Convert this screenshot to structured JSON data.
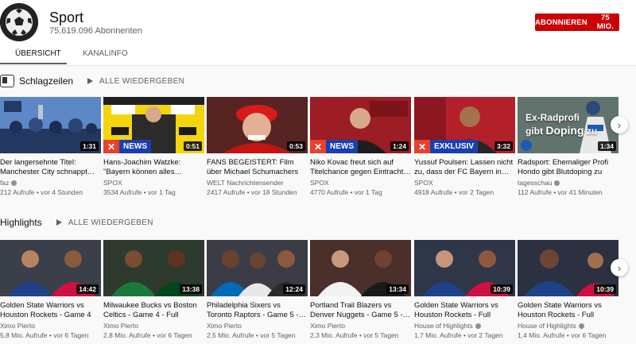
{
  "channel": {
    "title": "Sport",
    "subscribers": "75.619.096 Abonnenten",
    "subscribe_label": "ABONNIEREN",
    "subscribe_count": "75 MIO.",
    "accent": "#cc0000"
  },
  "tabs": [
    {
      "label": "ÜBERSICHT",
      "active": true
    },
    {
      "label": "KANALINFO",
      "active": false
    }
  ],
  "sections": [
    {
      "title": "Schlagzeilen",
      "play_all": "ALLE WIEDERGEBEN",
      "videos": [
        {
          "title": "Der langersehnte Titel: Manchester City schnappt…",
          "channel": "faz",
          "verified": true,
          "meta": "212 Aufrufe • vor 4 Stunden",
          "duration": "1:31",
          "badge": ""
        },
        {
          "title": "Hans-Joachim Watzke: \"Bayern können alles…",
          "channel": "SPOX",
          "verified": false,
          "meta": "3534 Aufrufe • vor 1 Tag",
          "duration": "0:51",
          "badge": "NEWS"
        },
        {
          "title": "FANS BEGEISTERT: Film über Michael Schumachers Lebe…",
          "channel": "WELT Nachrichtensender",
          "verified": false,
          "meta": "2417 Aufrufe • vor 18 Stunden",
          "duration": "0:53",
          "badge": ""
        },
        {
          "title": "Niko Kovac freut sich auf Titelchance gegen Eintracht…",
          "channel": "SPOX",
          "verified": false,
          "meta": "4770 Aufrufe • vor 1 Tag",
          "duration": "1:24",
          "badge": "NEWS"
        },
        {
          "title": "Yussuf Poulsen: Lassen nicht zu, dass der FC Bayern in…",
          "channel": "SPOX",
          "verified": false,
          "meta": "4918 Aufrufe • vor 2 Tagen",
          "duration": "3:32",
          "badge": "EXKLUSIV"
        },
        {
          "title": "Radsport: Ehemaliger Profi Hondo gibt Blutdoping zu",
          "channel": "tagesschau",
          "verified": true,
          "meta": "112 Aufrufe • vor 41 Minuten",
          "duration": "1:34",
          "badge": "",
          "overlay_line1": "Ex-Radprofi",
          "overlay_line2a": "gibt ",
          "overlay_line2b": "Doping",
          "overlay_line2c": " zu"
        }
      ]
    },
    {
      "title": "Highlights",
      "play_all": "ALLE WIEDERGEBEN",
      "videos": [
        {
          "title": "Golden State Warriors vs Houston Rockets - Game 4 -…",
          "channel": "Ximo Pierto",
          "verified": false,
          "meta": "5,8 Mio. Aufrufe • vor 6 Tagen",
          "duration": "14:42",
          "badge": ""
        },
        {
          "title": "Milwaukee Bucks vs Boston Celtics - Game 4 - Full Gam…",
          "channel": "Ximo Pierto",
          "verified": false,
          "meta": "2,8 Mio. Aufrufe • vor 6 Tagen",
          "duration": "13:38",
          "badge": ""
        },
        {
          "title": "Philadelphia Sixers vs Toronto Raptors - Game 5 -…",
          "channel": "Ximo Pierto",
          "verified": false,
          "meta": "2,5 Mio. Aufrufe • vor 5 Tagen",
          "duration": "12:24",
          "badge": ""
        },
        {
          "title": "Portland Trail Blazers vs Denver Nuggets - Game 5 -…",
          "channel": "Ximo Pierto",
          "verified": false,
          "meta": "2,3 Mio. Aufrufe • vor 5 Tagen",
          "duration": "13:34",
          "badge": ""
        },
        {
          "title": "Golden State Warriors vs Houston Rockets - Full Gam…",
          "channel": "House of Highlights",
          "verified": true,
          "meta": "1,7 Mio. Aufrufe • vor 2 Tagen",
          "duration": "10:39",
          "badge": ""
        },
        {
          "title": "Golden State Warriors vs Houston Rockets - Full Gam…",
          "channel": "House of Highlights",
          "verified": true,
          "meta": "1,4 Mio. Aufrufe • vor 6 Tagen",
          "duration": "10:39",
          "badge": ""
        }
      ]
    }
  ],
  "icons": {
    "next": "chevron-right-icon",
    "shelf": "shelf-icon",
    "play_all": "play-icon"
  }
}
